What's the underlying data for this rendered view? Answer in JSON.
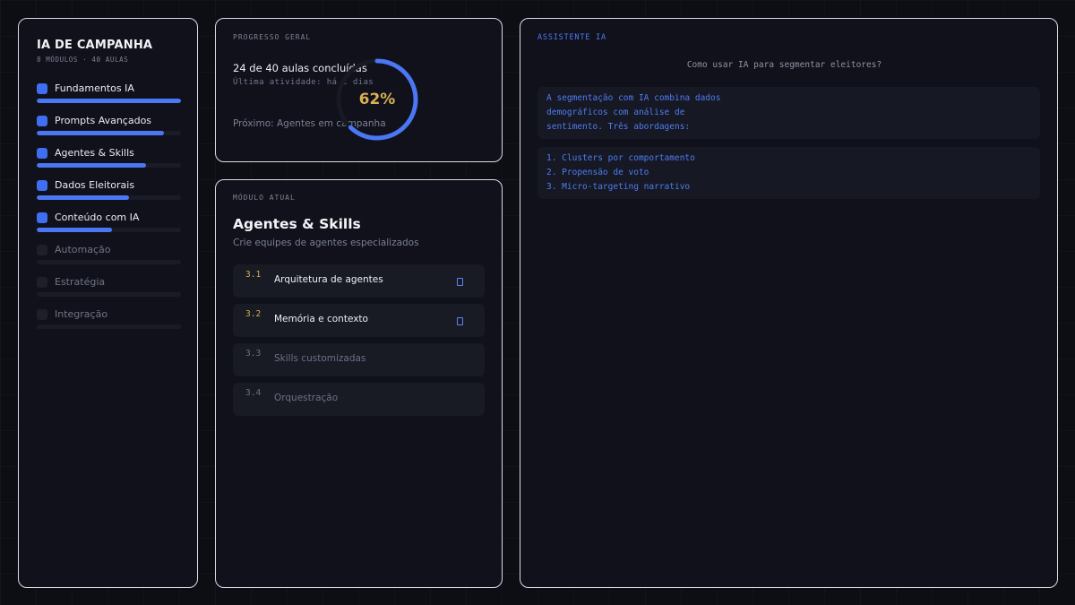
{
  "sidebar": {
    "title": "IA DE CAMPANHA",
    "subtitle": "8 MÓDULOS · 40 AULAS",
    "modules": [
      {
        "label": "Fundamentos IA",
        "progress": 1.0,
        "done": true
      },
      {
        "label": "Prompts Avançados",
        "progress": 0.88,
        "done": true
      },
      {
        "label": "Agentes & Skills",
        "progress": 0.76,
        "done": true
      },
      {
        "label": "Dados Eleitorais",
        "progress": 0.64,
        "done": true
      },
      {
        "label": "Conteúdo com IA",
        "progress": 0.52,
        "done": true
      },
      {
        "label": "Automação",
        "progress": 0,
        "done": false
      },
      {
        "label": "Estratégia",
        "progress": 0,
        "done": false
      },
      {
        "label": "Integração",
        "progress": 0,
        "done": false
      }
    ]
  },
  "progress": {
    "section_label": "PROGRESSO GERAL",
    "summary": "24 de 40 aulas concluídas",
    "last_activity": "Última atividade: há 2 dias",
    "next": "Próximo: Agentes em campanha",
    "percent_label": "62%",
    "percent": 0.62
  },
  "module": {
    "section_label": "MÓDULO ATUAL",
    "title": "Agentes & Skills",
    "subtitle": "Crie equipes de agentes especializados",
    "lessons": [
      {
        "num": "3.1",
        "title": "Arquitetura de agentes",
        "done": true
      },
      {
        "num": "3.2",
        "title": "Memória e contexto",
        "done": true
      },
      {
        "num": "3.3",
        "title": "Skills customizadas",
        "done": false
      },
      {
        "num": "3.4",
        "title": "Orquestração",
        "done": false
      }
    ]
  },
  "assistant": {
    "section_label": "ASSISTENTE IA",
    "question": "Como usar IA para segmentar eleitores?",
    "answer": "A segmentação com IA combina dados\ndemográficos com análise de\nsentimento. Três abordagens:",
    "list": "1. Clusters por comportamento\n2. Propensão de voto\n3. Micro-targeting narrativo"
  },
  "colors": {
    "accent": "#4b76f4",
    "gold": "#d9b052",
    "panel_border": "#d9dce6"
  }
}
